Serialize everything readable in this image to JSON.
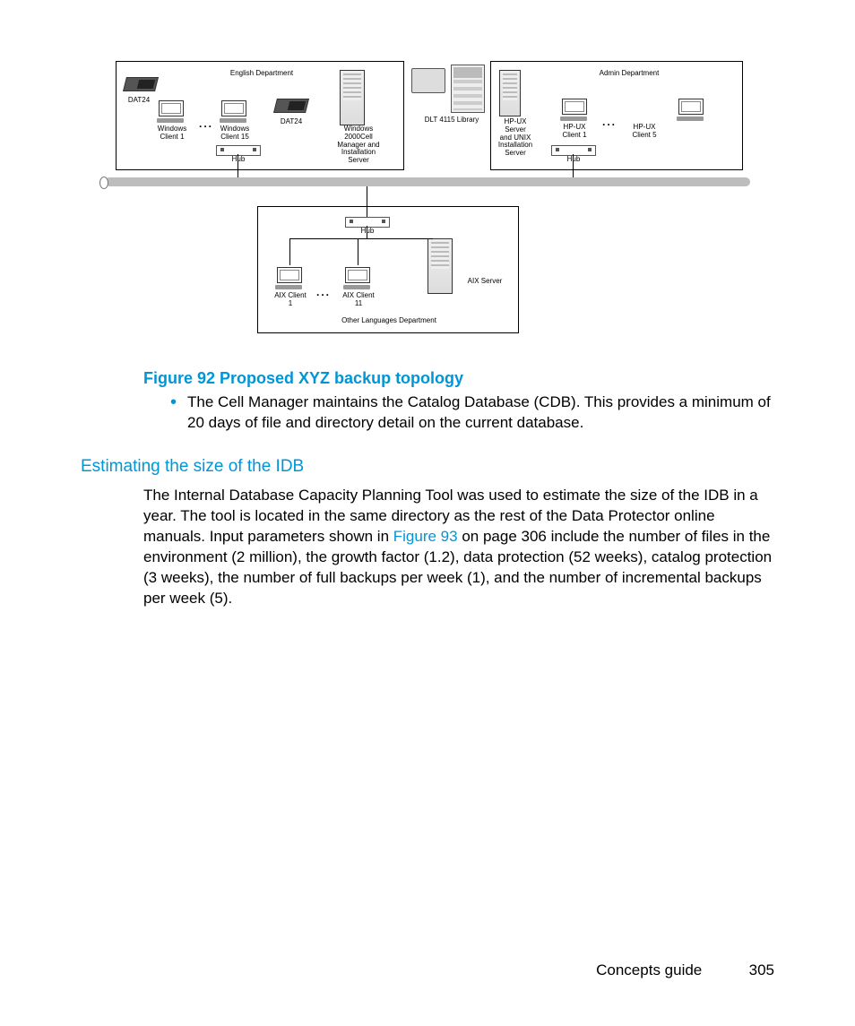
{
  "diagram": {
    "english_dept": "English Department",
    "admin_dept": "Admin Department",
    "other_dept": "Other Languages Department",
    "dat24": "DAT24",
    "win_client_1": "Windows\nClient 1",
    "win_client_15": "Windows\nClient 15",
    "win_cell": "Windows\n2000Cell\nManager and\nInstallation\nServer",
    "dlt": "DLT 4115 Library",
    "hpux_server": "HP-UX\nServer\nand UNIX\nInstallation\nServer",
    "hpux_client_1": "HP-UX\nClient 1",
    "hpux_client_5": "HP-UX\nClient 5",
    "hub": "Hub",
    "aix_client_1": "AIX Client\n1",
    "aix_client_11": "AIX Client\n11",
    "aix_server": "AIX Server"
  },
  "figure_caption": "Figure 92 Proposed XYZ backup topology",
  "bullet": "The Cell Manager maintains the Catalog Database (CDB). This provides a minimum of 20 days of file and directory detail on the current database.",
  "section_heading": "Estimating the size of the IDB",
  "para_pre": "The Internal Database Capacity Planning Tool was used to estimate the size of the IDB in a year. The tool is located in the same directory as the rest of the Data Protector online manuals. Input parameters shown in ",
  "para_link": "Figure 93",
  "para_post": " on page 306 include the number of files in the environment (2 million), the growth factor (1.2), data protection (52 weeks), catalog protection (3 weeks), the number of full backups per week (1), and the number of incremental backups per week (5).",
  "footer_title": "Concepts guide",
  "footer_page": "305"
}
